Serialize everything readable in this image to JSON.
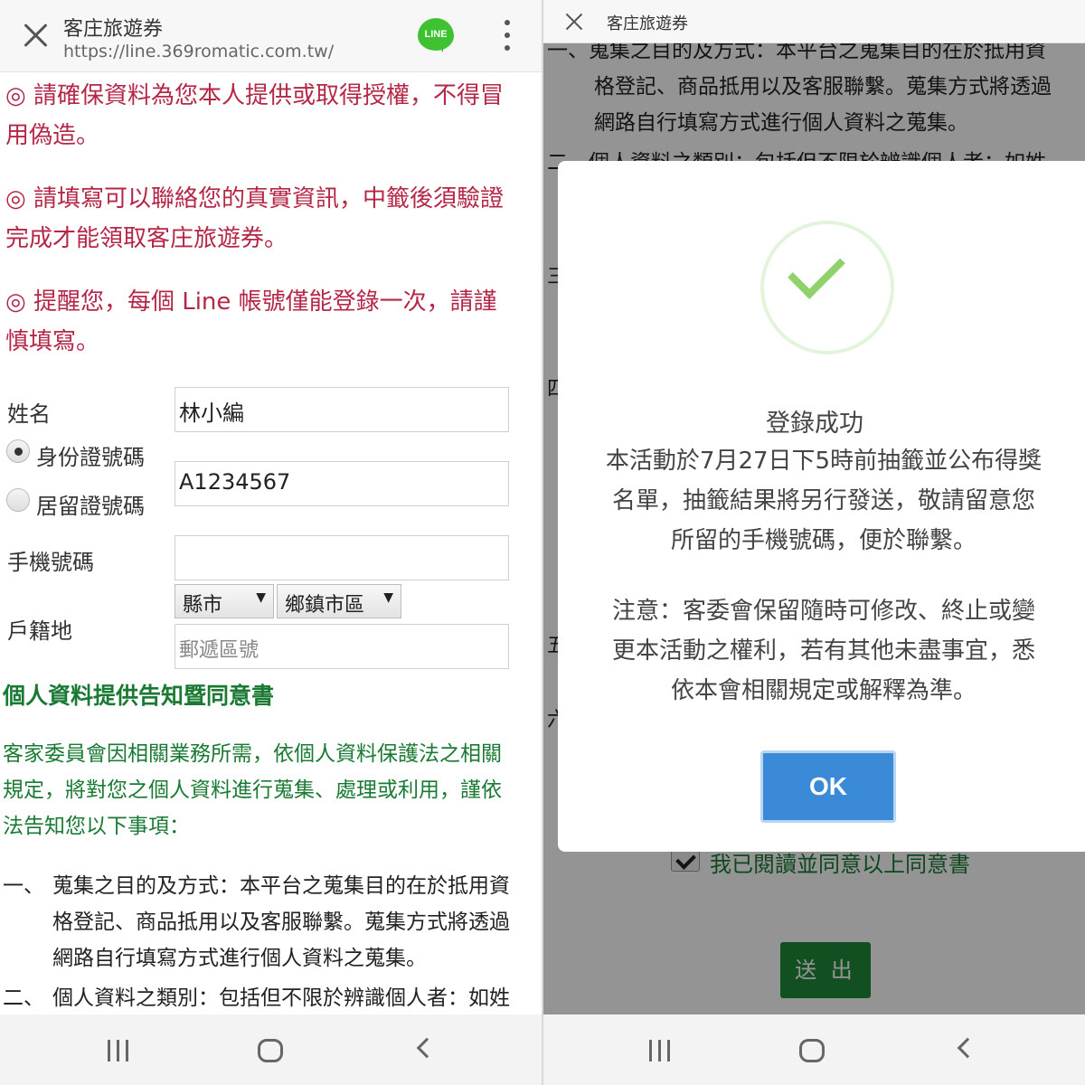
{
  "left": {
    "browser": {
      "title": "客庄旅遊券",
      "url": "https://line.369romatic.com.tw/",
      "line_badge": "LINE"
    },
    "notices": [
      {
        "line1": "◎ 請確保資料為您本人提供或取得授權，不得冒",
        "line2": "用偽造。"
      },
      {
        "line1": "◎ 請填寫可以聯絡您的真實資訊，中籤後須驗證",
        "line2": "完成才能領取客庄旅遊券。"
      },
      {
        "line1": "◎ 提醒您，每個 Line 帳號僅能登錄一次，請謹",
        "line2": "慎填寫。"
      }
    ],
    "form": {
      "name_label": "姓名",
      "name_value": "林小編",
      "id_label": "身份證號碼",
      "resident_label": "居留證號碼",
      "id_value": "A1234567",
      "phone_label": "手機號碼",
      "phone_value": "",
      "household_label": "戶籍地",
      "county_select": "縣市",
      "town_select": "鄉鎮市區",
      "postal_placeholder": "郵遞區號"
    },
    "consent": {
      "title": "個人資料提供告知暨同意書",
      "para_lines": [
        "客家委員會因相關業務所需，依個人資料保護法之相關",
        "規定，將對您之個人資料進行蒐集、處理或利用，謹依",
        "法告知您以下事項："
      ],
      "term1_num": "一、",
      "term1_lines": [
        "蒐集之目的及方式：本平台之蒐集目的在於抵用資",
        "格登記、商品抵用以及客服聯繫。蒐集方式將透過",
        "網路自行填寫方式進行個人資料之蒐集。"
      ],
      "term2_num": "二、",
      "term2_line": "個人資料之類別：包括但不限於辨識個人者：如姓"
    }
  },
  "right": {
    "browser_title": "客庄旅遊券",
    "bg_term1_lines": [
      "一、蒐集之目的及方式：本平台之蒐集目的在於抵用資",
      "格登記、商品抵用以及客服聯繫。蒐集方式將透過",
      "網路自行填寫方式進行個人資料之蒐集。"
    ],
    "bg_term2_line": "二、個人資料之類別：包括但不限於辨識個人者：如姓",
    "bg_nums": [
      "三",
      "四",
      "五",
      "六"
    ],
    "agree_label": "我已閱讀並同意以上同意書",
    "submit_label": "送 出",
    "modal": {
      "title": "登錄成功",
      "body_lines": [
        "本活動於7月27日下5時前抽籤並公布得獎",
        "名單，抽籤結果將另行發送，敬請留意您",
        "所留的手機號碼，便於聯繫。"
      ],
      "note_lines": [
        "注意：客委會保留隨時可修改、終止或變",
        "更本活動之權利，若有其他未盡事宜，悉",
        "依本會相關規定或解釋為準。"
      ],
      "ok_label": "OK"
    }
  },
  "colors": {
    "notice_red": "#b52747",
    "consent_green": "#1a7a34",
    "ok_blue": "#3a8ad8",
    "check_green": "#8fd16a"
  },
  "icons": [
    "close-icon",
    "line-app-icon",
    "more-vert-icon",
    "check-circle-icon",
    "nav-recent-icon",
    "nav-home-icon",
    "nav-back-icon"
  ]
}
